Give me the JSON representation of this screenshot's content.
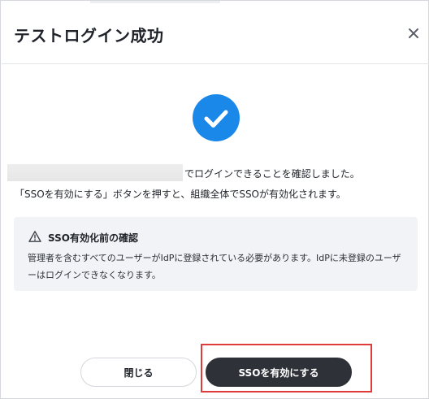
{
  "dialog": {
    "title": "テストログイン成功",
    "close_icon": "close-icon"
  },
  "status_icon": "check-circle-icon",
  "message": {
    "line1": "でログインできることを確認しました。",
    "line2": "「SSOを有効にする」ボタンを押すと、組織全体でSSOが有効化されます。"
  },
  "notice": {
    "icon": "warning-icon",
    "title": "SSO有効化前の確認",
    "body": "管理者を含むすべてのユーザーがIdPに登録されている必要があります。IdPに未登録のユーザーはログインできなくなります。"
  },
  "buttons": {
    "close_label": "閉じる",
    "enable_label": "SSOを有効にする"
  },
  "colors": {
    "accent": "#1a88e8",
    "primary_button": "#2e3138",
    "highlight": "#e03b3b"
  }
}
